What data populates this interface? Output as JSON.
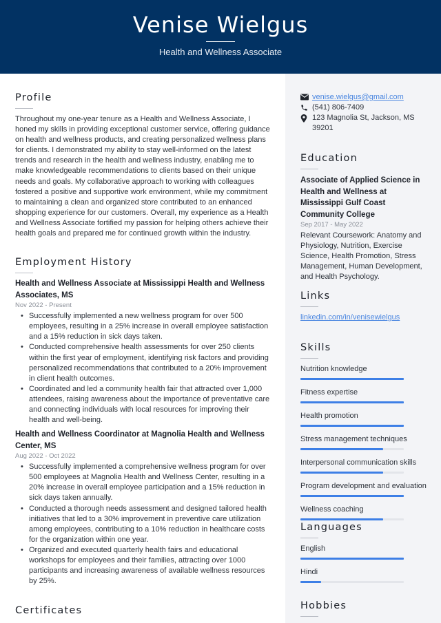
{
  "header": {
    "name": "Venise Wielgus",
    "title": "Health and Wellness Associate"
  },
  "profile": {
    "heading": "Profile",
    "text": "Throughout my one-year tenure as a Health and Wellness Associate, I honed my skills in providing exceptional customer service, offering guidance on health and wellness products, and creating personalized wellness plans for clients. I demonstrated my ability to stay well-informed on the latest trends and research in the health and wellness industry, enabling me to make knowledgeable recommendations to clients based on their unique needs and goals. My collaborative approach to working with colleagues fostered a positive and supportive work environment, while my commitment to maintaining a clean and organized store contributed to an enhanced shopping experience for our customers. Overall, my experience as a Health and Wellness Associate fortified my passion for helping others achieve their health goals and prepared me for continued growth within the industry."
  },
  "employment": {
    "heading": "Employment History",
    "jobs": [
      {
        "title": "Health and Wellness Associate at Mississippi Health and Wellness Associates, MS",
        "date": "Nov 2022 - Present",
        "bullets": [
          "Successfully implemented a new wellness program for over 500 employees, resulting in a 25% increase in overall employee satisfaction and a 15% reduction in sick days taken.",
          "Conducted comprehensive health assessments for over 250 clients within the first year of employment, identifying risk factors and providing personalized recommendations that contributed to a 20% improvement in client health outcomes.",
          "Coordinated and led a community health fair that attracted over 1,000 attendees, raising awareness about the importance of preventative care and connecting individuals with local resources for improving their health and well-being."
        ]
      },
      {
        "title": "Health and Wellness Coordinator at Magnolia Health and Wellness Center, MS",
        "date": "Aug 2022 - Oct 2022",
        "bullets": [
          "Successfully implemented a comprehensive wellness program for over 500 employees at Magnolia Health and Wellness Center, resulting in a 20% increase in overall employee participation and a 15% reduction in sick days taken annually.",
          "Conducted a thorough needs assessment and designed tailored health initiatives that led to a 30% improvement in preventive care utilization among employees, contributing to a 10% reduction in healthcare costs for the organization within one year.",
          "Organized and executed quarterly health fairs and educational workshops for employees and their families, attracting over 1000 participants and increasing awareness of available wellness resources by 25%."
        ]
      }
    ]
  },
  "certificates": {
    "heading": "Certificates"
  },
  "contact": {
    "email": "venise.wielgus@gmail.com",
    "phone": "(541) 806-7409",
    "address": "123 Magnolia St, Jackson, MS 39201",
    "icons": [
      "envelope-icon",
      "phone-icon",
      "map-pin-icon"
    ]
  },
  "education": {
    "heading": "Education",
    "degree": "Associate of Applied Science in Health and Wellness at Mississippi Gulf Coast Community College",
    "date": "Sep 2017 - May 2022",
    "description": "Relevant Coursework: Anatomy and Physiology, Nutrition, Exercise Science, Health Promotion, Stress Management, Human Development, and Health Psychology."
  },
  "links": {
    "heading": "Links",
    "items": [
      "linkedin.com/in/venisewielgus"
    ]
  },
  "skills": {
    "heading": "Skills",
    "items": [
      {
        "label": "Nutrition knowledge",
        "level": 1.0
      },
      {
        "label": "Fitness expertise",
        "level": 1.0
      },
      {
        "label": "Health promotion",
        "level": 1.0
      },
      {
        "label": "Stress management techniques",
        "level": 0.8
      },
      {
        "label": "Interpersonal communication skills",
        "level": 0.8
      },
      {
        "label": "Program development and evaluation",
        "level": 1.0
      },
      {
        "label": "Wellness coaching",
        "level": 0.8
      }
    ]
  },
  "languages": {
    "heading": "Languages",
    "items": [
      {
        "label": "English",
        "level": 1.0
      },
      {
        "label": "Hindi",
        "level": 0.2
      }
    ]
  },
  "hobbies": {
    "heading": "Hobbies"
  },
  "colors": {
    "header_bg": "#023263",
    "accent": "#3d7fe6",
    "link": "#4a86e0",
    "sidebar_bg": "#f3f4f7"
  }
}
